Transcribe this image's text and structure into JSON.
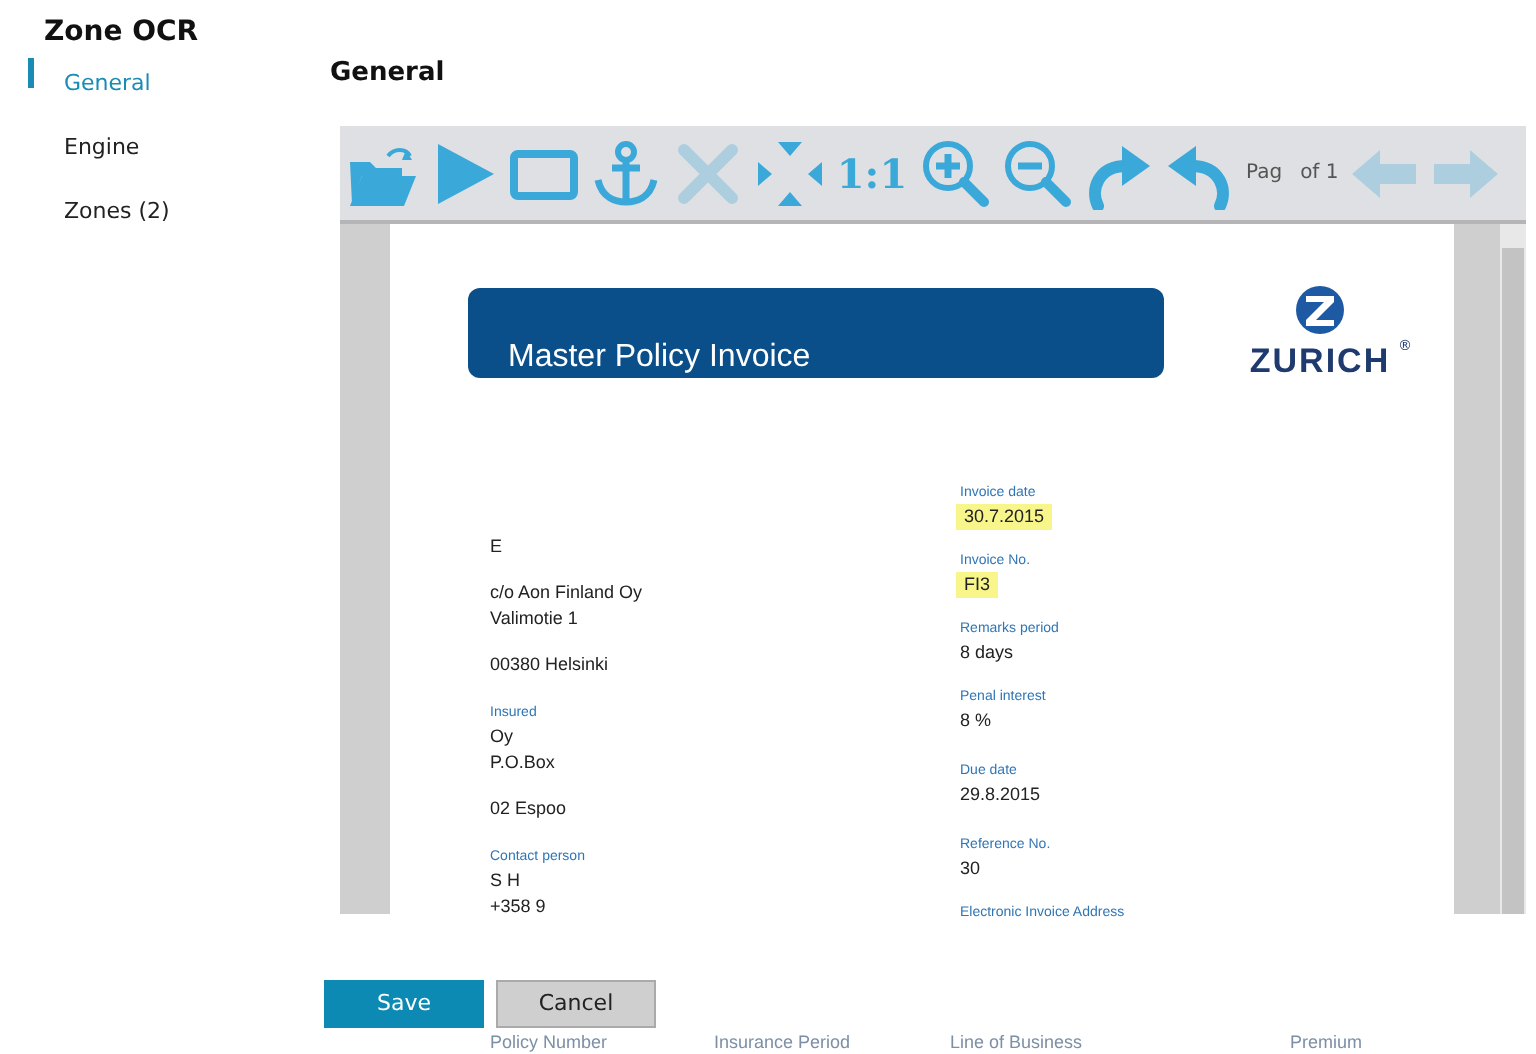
{
  "app_title": "Zone OCR",
  "sidebar": {
    "items": [
      {
        "label": "General",
        "selected": true
      },
      {
        "label": "Engine",
        "selected": false
      },
      {
        "label": "Zones (2)",
        "selected": false
      }
    ]
  },
  "heading": "General",
  "viewer": {
    "toolbar": [
      {
        "kind": "open",
        "disabled": false
      },
      {
        "kind": "play",
        "disabled": false
      },
      {
        "kind": "rectangle",
        "disabled": false
      },
      {
        "kind": "anchor",
        "disabled": false
      },
      {
        "kind": "delete",
        "disabled": true
      },
      {
        "kind": "fit",
        "disabled": false
      },
      {
        "kind": "actual-size",
        "text": "1:1",
        "disabled": false
      },
      {
        "kind": "zoom-in",
        "disabled": false
      },
      {
        "kind": "zoom-out",
        "disabled": false
      },
      {
        "kind": "redo",
        "disabled": false
      },
      {
        "kind": "undo",
        "disabled": false
      },
      {
        "kind": "previous",
        "disabled": true
      },
      {
        "kind": "next",
        "disabled": true
      }
    ],
    "page_label": "Pag",
    "page_total": "of 1",
    "document": {
      "banner_title": "Master Policy Invoice",
      "logo_text": "ZURICH",
      "logo_mark": "®",
      "left_blocks": [
        {
          "lines": [
            "E"
          ]
        },
        {
          "lines": [
            "c/o Aon Finland Oy",
            "Valimotie 1"
          ]
        },
        {
          "lines": [
            "00380  Helsinki"
          ]
        },
        {
          "label": "Insured",
          "lines": [
            "Oy",
            "P.O.Box"
          ]
        },
        {
          "lines": [
            "02  Espoo"
          ]
        },
        {
          "label": "Contact person",
          "lines": [
            "S H",
            "+358 9"
          ]
        }
      ],
      "right_blocks": [
        {
          "label": "Invoice date",
          "value": "30.7.2015",
          "highlighted": true
        },
        {
          "label": "Invoice No.",
          "value": "FI3",
          "highlighted": true
        },
        {
          "label": "Remarks period",
          "value": "8 days",
          "highlighted": false
        },
        {
          "label": "Penal interest",
          "value": "8 %",
          "highlighted": false
        },
        {
          "label": "Due date",
          "value": "29.8.2015",
          "highlighted": false
        },
        {
          "label": "Reference No.",
          "value": "30",
          "highlighted": false
        },
        {
          "label": "Electronic Invoice Address"
        }
      ],
      "table_columns": [
        "Policy Number",
        "Insurance Period",
        "Line of Business",
        "Premium"
      ]
    }
  },
  "buttons": [
    {
      "kind": "primary",
      "label": "Save"
    },
    {
      "kind": "secondary",
      "label": "Cancel"
    }
  ]
}
